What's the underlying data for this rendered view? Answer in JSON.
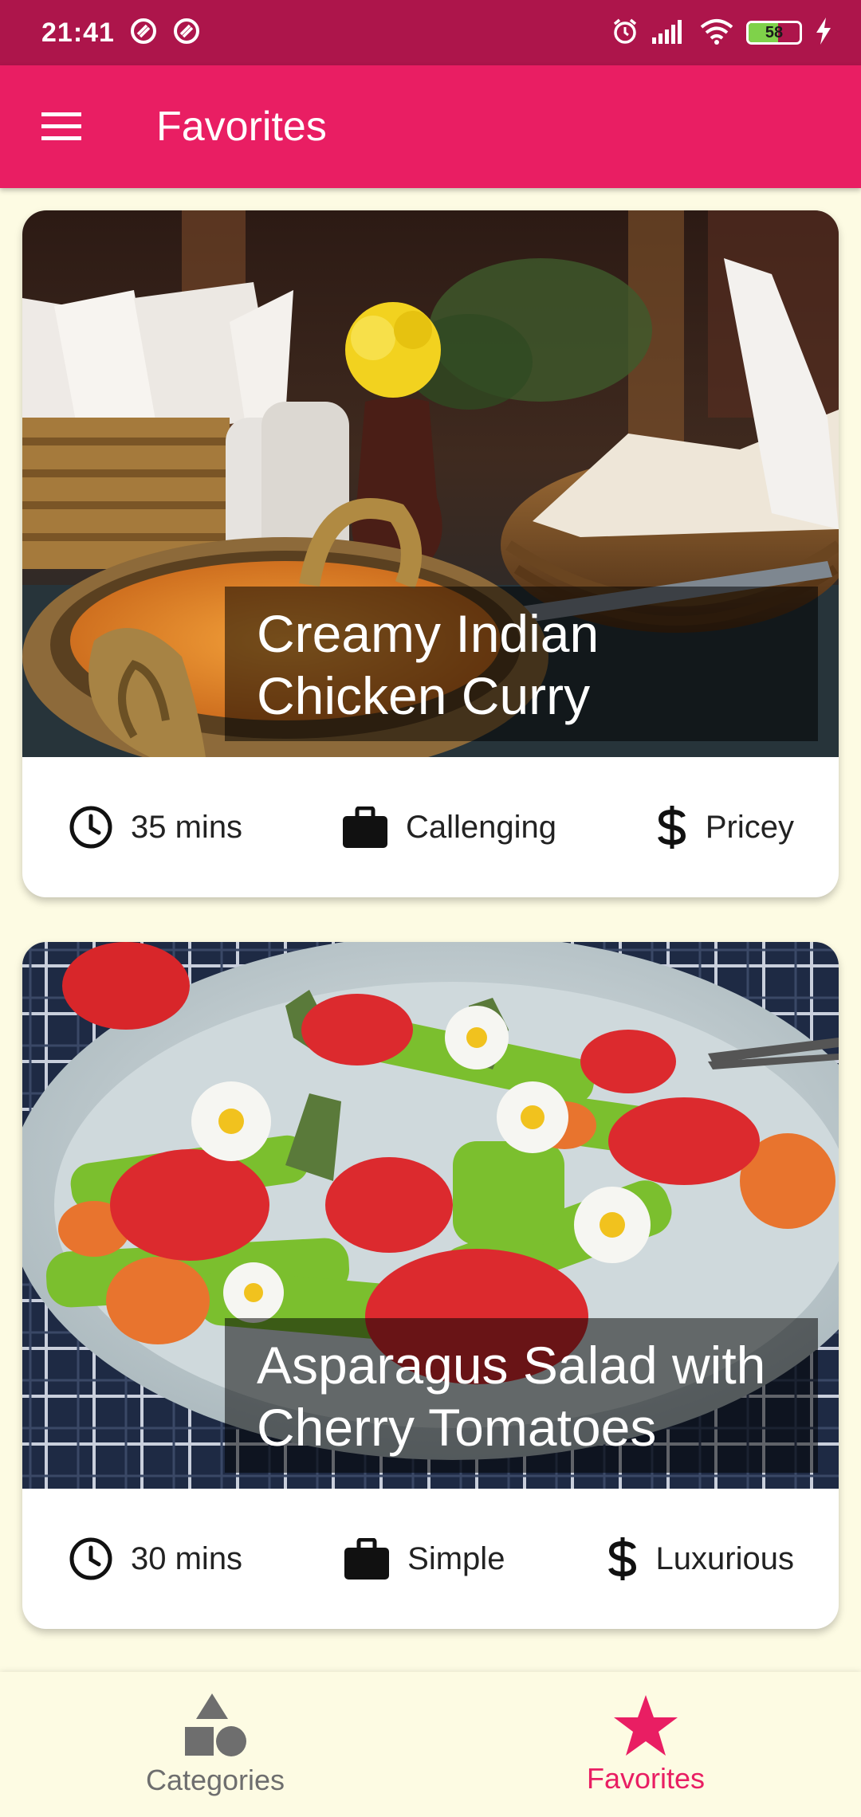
{
  "status_bar": {
    "time": "21:41",
    "battery_level": "58",
    "battery_fraction": 0.58,
    "icons": [
      "alarm-icon",
      "signal-icon",
      "wifi-icon",
      "battery-icon",
      "charging-icon"
    ]
  },
  "app_bar": {
    "title": "Favorites",
    "menu_icon": "hamburger-menu-icon",
    "color": "#e91e63"
  },
  "meals": [
    {
      "title": "Creamy Indian Chicken Curry",
      "duration": "35 mins",
      "complexity": "Callenging",
      "affordability": "Pricey"
    },
    {
      "title": "Asparagus Salad with Cherry Tomatoes",
      "duration": "30 mins",
      "complexity": "Simple",
      "affordability": "Luxurious"
    }
  ],
  "bottom_nav": {
    "items": [
      {
        "label": "Categories",
        "icon": "category-shapes-icon",
        "active": false
      },
      {
        "label": "Favorites",
        "icon": "star-icon",
        "active": true
      }
    ]
  },
  "colors": {
    "primary": "#e91e63",
    "status_bar": "#ad154b",
    "background": "#fdfbe3"
  }
}
